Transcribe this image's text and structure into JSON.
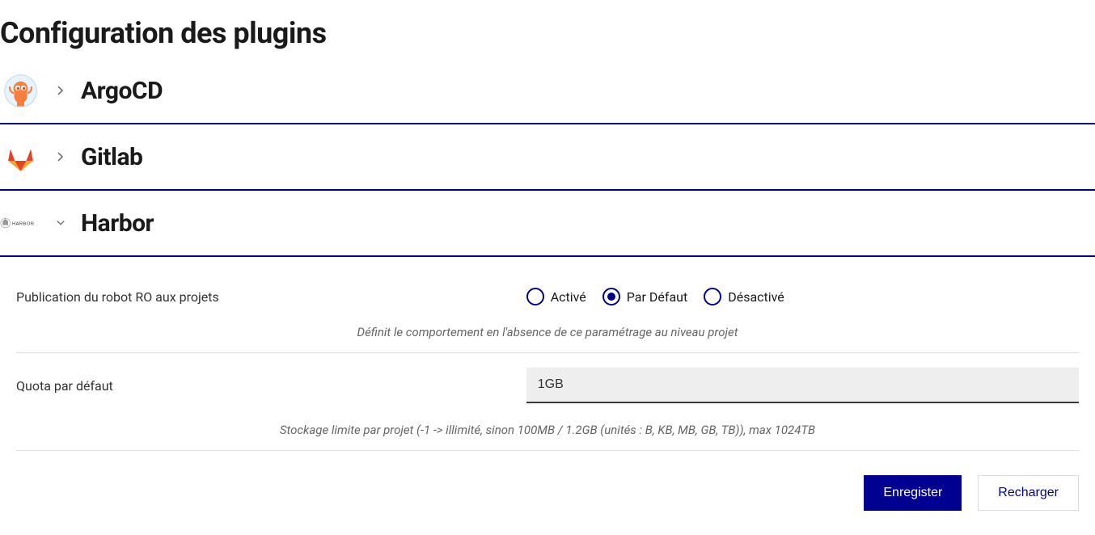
{
  "page": {
    "title": "Configuration des plugins"
  },
  "plugins": [
    {
      "id": "argocd",
      "name": "ArgoCD",
      "expanded": false
    },
    {
      "id": "gitlab",
      "name": "Gitlab",
      "expanded": false
    },
    {
      "id": "harbor",
      "name": "Harbor",
      "expanded": true
    }
  ],
  "harbor": {
    "publication": {
      "label": "Publication du robot RO aux projets",
      "options": {
        "active": "Activé",
        "default": "Par Défaut",
        "disabled": "Désactivé"
      },
      "selected": "default",
      "description": "Définit le comportement en l'absence de ce paramétrage au niveau projet"
    },
    "quota": {
      "label": "Quota par défaut",
      "value": "1GB",
      "description": "Stockage limite par projet (-1 -> illimité, sinon 100MB / 1.2GB (unités : B, KB, MB, GB, TB)), max 1024TB"
    }
  },
  "buttons": {
    "save": "Enregister",
    "reload": "Recharger"
  }
}
